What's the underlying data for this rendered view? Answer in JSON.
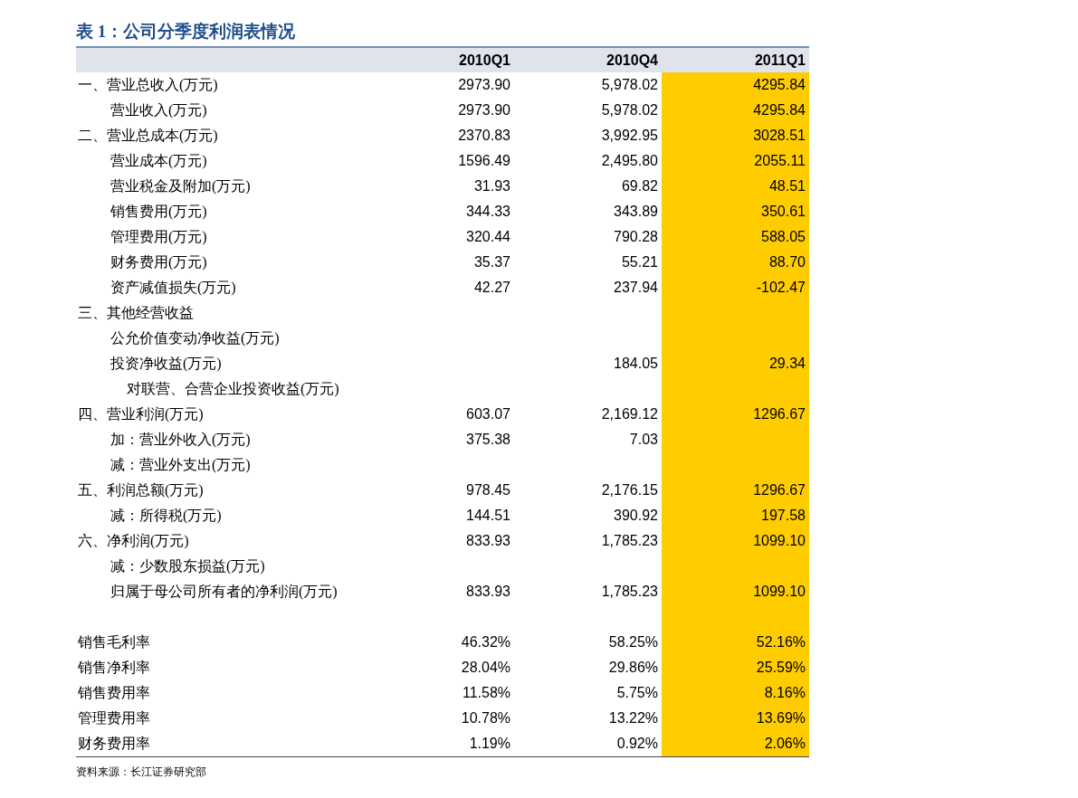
{
  "title": "表 1：公司分季度利润表情况",
  "table": {
    "columns": [
      {
        "label": "2010Q1",
        "highlighted": false
      },
      {
        "label": "2010Q4",
        "highlighted": false
      },
      {
        "label": "2011Q1",
        "highlighted": true
      }
    ],
    "rows": [
      {
        "label": "一、营业总收入(万元)",
        "values": {
          "col_1": "2973.90",
          "col_2": "5,978.02",
          "col_3": "4295.84"
        },
        "children": [
          {
            "label": "营业收入(万元)",
            "values": {
              "col_1": "2973.90",
              "col_2": "5,978.02",
              "col_3": "4295.84"
            }
          }
        ]
      },
      {
        "label": "二、营业总成本(万元)",
        "values": {
          "col_1": "2370.83",
          "col_2": "3,992.95",
          "col_3": "3028.51"
        },
        "children": [
          {
            "label": "营业成本(万元)",
            "values": {
              "col_1": "1596.49",
              "col_2": "2,495.80",
              "col_3": "2055.11"
            }
          },
          {
            "label": "营业税金及附加(万元)",
            "values": {
              "col_1": "31.93",
              "col_2": "69.82",
              "col_3": "48.51"
            }
          },
          {
            "label": "销售费用(万元)",
            "values": {
              "col_1": "344.33",
              "col_2": "343.89",
              "col_3": "350.61"
            }
          },
          {
            "label": "管理费用(万元)",
            "values": {
              "col_1": "320.44",
              "col_2": "790.28",
              "col_3": "588.05"
            }
          },
          {
            "label": "财务费用(万元)",
            "values": {
              "col_1": "35.37",
              "col_2": "55.21",
              "col_3": "88.70"
            }
          },
          {
            "label": "资产减值损失(万元)",
            "values": {
              "col_1": "42.27",
              "col_2": "237.94",
              "col_3": "-102.47"
            }
          }
        ]
      },
      {
        "label": "三、其他经营收益",
        "children": [
          {
            "label": "公允价值变动净收益(万元)"
          },
          {
            "label": "投资净收益(万元)",
            "values": {
              "col_2": "184.05",
              "col_3": "29.34"
            },
            "children": [
              {
                "label": "对联营、合营企业投资收益(万元)"
              }
            ]
          }
        ]
      },
      {
        "label": "四、营业利润(万元)",
        "values": {
          "col_1": "603.07",
          "col_2": "2,169.12",
          "col_3": "1296.67"
        },
        "children": [
          {
            "label": "加：营业外收入(万元)",
            "values": {
              "col_1": "375.38",
              "col_2": "7.03"
            }
          },
          {
            "label": "减：营业外支出(万元)"
          }
        ]
      },
      {
        "label": "五、利润总额(万元)",
        "values": {
          "col_1": "978.45",
          "col_2": "2,176.15",
          "col_3": "1296.67"
        },
        "children": [
          {
            "label": "减：所得税(万元)",
            "values": {
              "col_1": "144.51",
              "col_2": "390.92",
              "col_3": "197.58"
            }
          }
        ]
      },
      {
        "label": "六、净利润(万元)",
        "values": {
          "col_1": "833.93",
          "col_2": "1,785.23",
          "col_3": "1099.10"
        },
        "children": [
          {
            "label": "减：少数股东损益(万元)"
          },
          {
            "label": "归属于母公司所有者的净利润(万元)",
            "values": {
              "col_1": "833.93",
              "col_2": "1,785.23",
              "col_3": "1099.10"
            }
          }
        ]
      }
    ],
    "ratios": [
      {
        "label": "销售毛利率",
        "values": {
          "col_1": "46.32%",
          "col_2": "58.25%",
          "col_3": "52.16%"
        }
      },
      {
        "label": "销售净利率",
        "values": {
          "col_1": "28.04%",
          "col_2": "29.86%",
          "col_3": "25.59%"
        }
      },
      {
        "label": "销售费用率",
        "values": {
          "col_1": "11.58%",
          "col_2": "5.75%",
          "col_3": "8.16%"
        }
      },
      {
        "label": "管理费用率",
        "values": {
          "col_1": "10.78%",
          "col_2": "13.22%",
          "col_3": "13.69%"
        }
      },
      {
        "label": "财务费用率",
        "values": {
          "col_1": "1.19%",
          "col_2": "0.92%",
          "col_3": "2.06%"
        }
      }
    ]
  },
  "source": "资料来源：长江证券研究部"
}
